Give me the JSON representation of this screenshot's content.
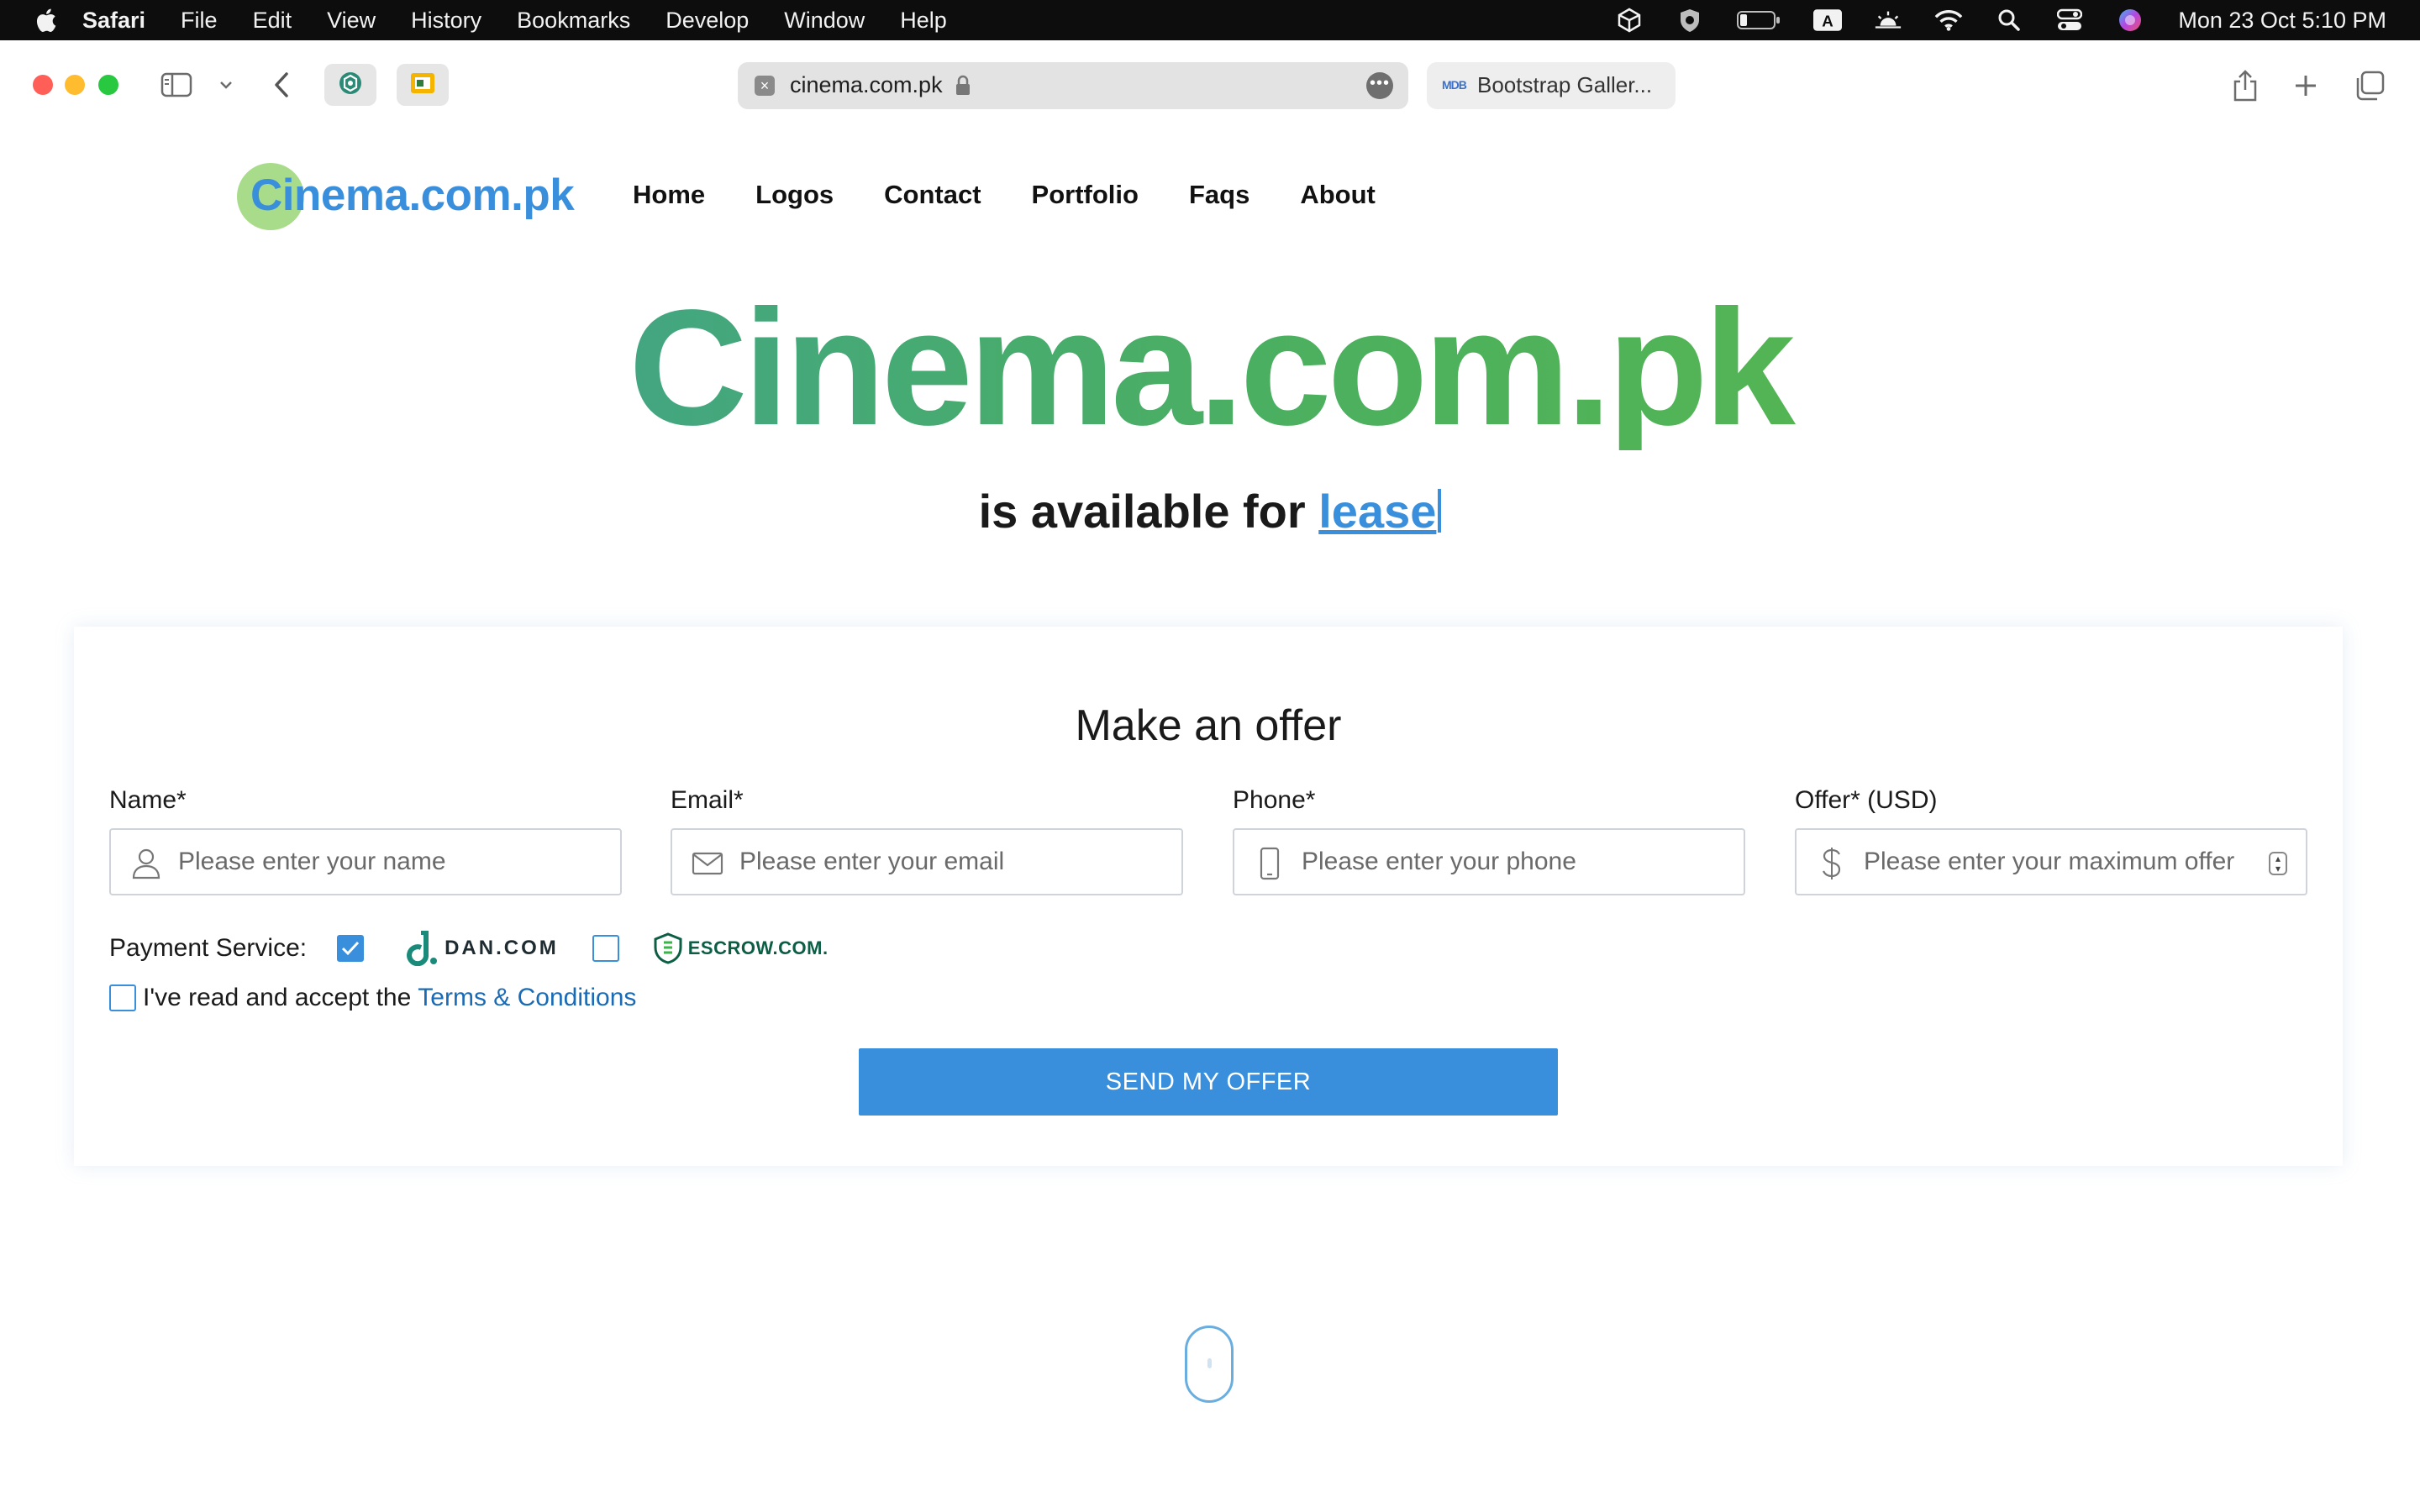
{
  "menubar": {
    "app": "Safari",
    "items": [
      "File",
      "Edit",
      "View",
      "History",
      "Bookmarks",
      "Develop",
      "Window",
      "Help"
    ],
    "clock": "Mon 23 Oct  5:10 PM",
    "status_icons": [
      "unity-icon",
      "shield-icon",
      "battery-icon",
      "keyboard-input-icon",
      "brightness-icon",
      "wifi-icon",
      "spotlight-search-icon",
      "control-center-icon",
      "siri-icon"
    ]
  },
  "browser": {
    "url": "cinema.com.pk",
    "second_tab_title": "Bootstrap Galler...",
    "second_tab_badge": "MDB"
  },
  "site": {
    "logo_text": "Cinema.com.pk",
    "nav": [
      "Home",
      "Logos",
      "Contact",
      "Portfolio",
      "Faqs",
      "About"
    ],
    "hero_title": "Cinema.com.pk",
    "hero_prefix": "is available for",
    "hero_highlight": "lease",
    "gradient_colors": [
      "#3a9da0",
      "#4cb05e",
      "#5dbb47"
    ],
    "accent_color": "#3a8fdc"
  },
  "form": {
    "title": "Make an offer",
    "fields": [
      {
        "label": "Name*",
        "placeholder": "Please enter your name",
        "icon": "user-icon"
      },
      {
        "label": "Email*",
        "placeholder": "Please enter your email",
        "icon": "envelope-icon"
      },
      {
        "label": "Phone*",
        "placeholder": "Please enter your phone",
        "icon": "phone-icon"
      },
      {
        "label": "Offer* (USD)",
        "placeholder": "Please enter your maximum offer",
        "icon": "dollar-icon"
      }
    ],
    "payment_label": "Payment Service:",
    "payment_options": [
      {
        "name": "DAN.COM",
        "checked": true
      },
      {
        "name": "ESCROW.COM.",
        "checked": false
      }
    ],
    "terms_text": "I've read and accept the",
    "terms_link": "Terms & Conditions",
    "terms_checked": false,
    "submit_label": "SEND MY OFFER"
  }
}
